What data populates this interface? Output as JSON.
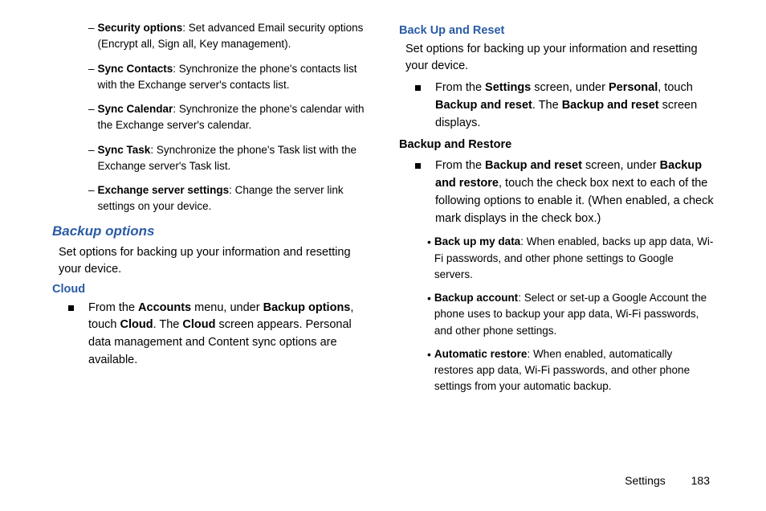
{
  "left": {
    "items": [
      {
        "term": "Security options",
        "desc": ": Set advanced Email security options (Encrypt all, Sign all, Key management)."
      },
      {
        "term": "Sync Contacts",
        "desc": ": Synchronize the phone's contacts list with the Exchange server's contacts list."
      },
      {
        "term": "Sync Calendar",
        "desc": ": Synchronize the phone's calendar with the Exchange server's calendar."
      },
      {
        "term": "Sync Task",
        "desc": ": Synchronize the phone's Task list with the Exchange server's Task list."
      },
      {
        "term": "Exchange server settings",
        "desc": ": Change the server link settings on your device."
      }
    ],
    "backup_heading": "Backup options",
    "backup_intro": "Set options for backing up your information and resetting your device.",
    "cloud_heading": "Cloud",
    "cloud_step": {
      "pre": "From the ",
      "b1": "Accounts",
      "mid1": " menu, under ",
      "b2": "Backup options",
      "mid2": ", touch ",
      "b3": "Cloud",
      "mid3": ". The ",
      "b4": "Cloud",
      "post": " screen appears. Personal data management and Content sync options are available."
    }
  },
  "right": {
    "heading": "Back Up and Reset",
    "intro": "Set options for backing up your information and resetting your device.",
    "step1": {
      "pre": "From the ",
      "b1": "Settings",
      "mid1": " screen, under ",
      "b2": "Personal",
      "mid2": ", touch ",
      "b3": "Backup and reset",
      "mid3": ". The ",
      "b4": "Backup and reset",
      "post": " screen displays."
    },
    "sub_heading": "Backup and Restore",
    "step2": {
      "pre": "From the ",
      "b1": "Backup and reset",
      "mid1": " screen, under ",
      "b2": "Backup and restore",
      "post": ", touch the check box next to each of the following options to enable it. (When enabled, a check mark displays in the check box.)"
    },
    "bullets": [
      {
        "term": "Back up my data",
        "desc": ": When enabled, backs up app data, Wi-Fi passwords, and other phone settings to Google servers."
      },
      {
        "term": "Backup account",
        "desc": ": Select or set-up a Google Account the phone uses to backup your app data, Wi-Fi passwords, and other phone settings."
      },
      {
        "term": "Automatic restore",
        "desc": ": When enabled, automatically restores app data, Wi-Fi passwords, and other phone settings from your automatic backup."
      }
    ]
  },
  "footer": {
    "section": "Settings",
    "page": "183"
  }
}
